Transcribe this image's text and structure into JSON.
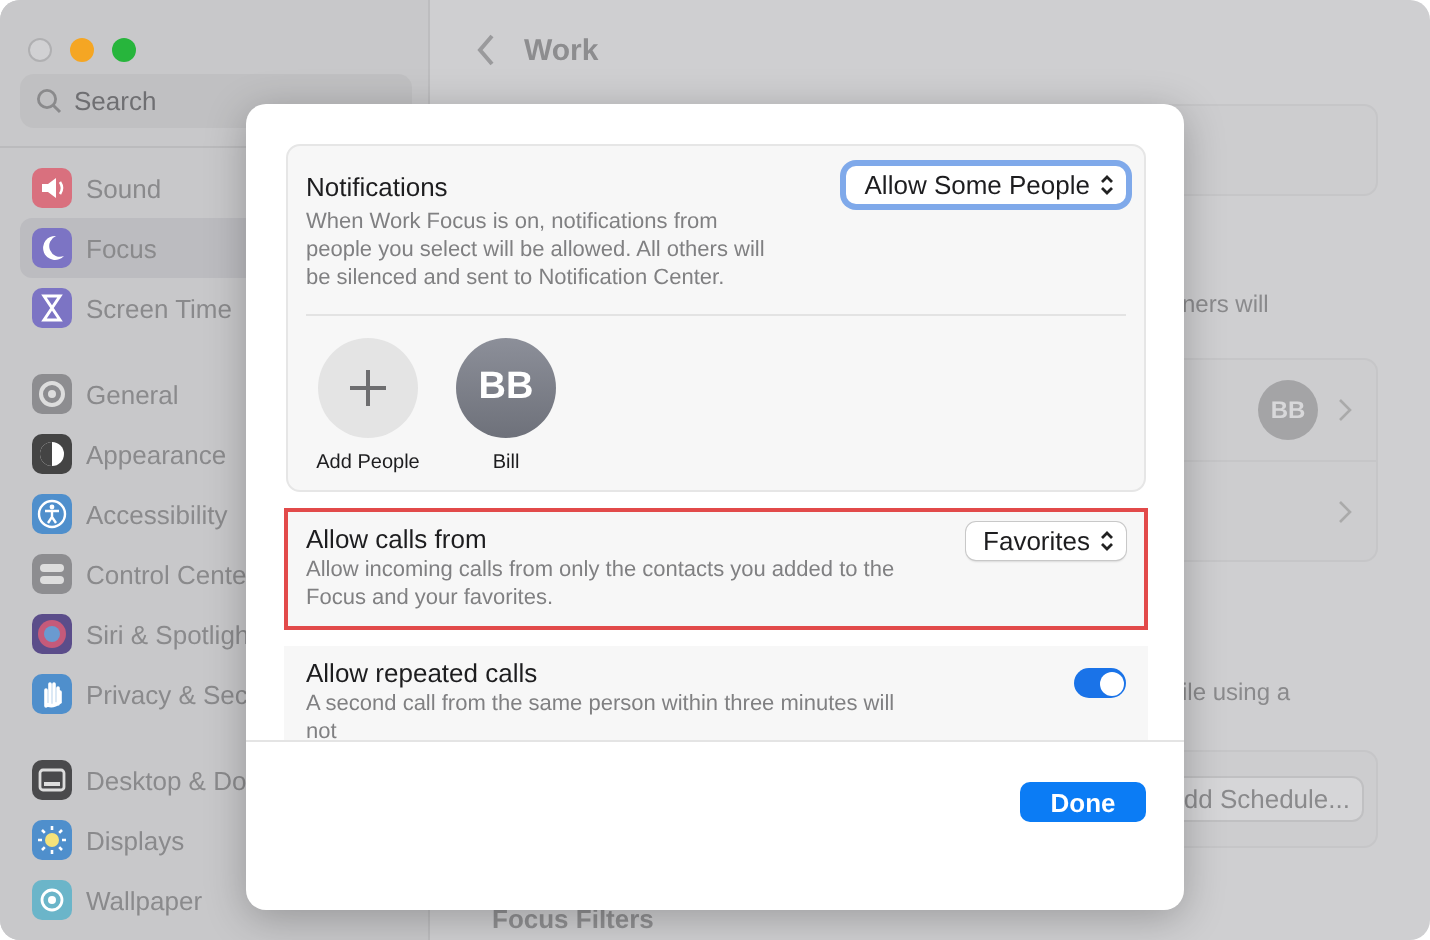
{
  "window": {
    "title": "Work"
  },
  "sidebar": {
    "search": {
      "placeholder": "Search"
    },
    "groups": [
      [
        {
          "label": "Sound",
          "selected": false
        },
        {
          "label": "Focus",
          "selected": true
        },
        {
          "label": "Screen Time",
          "selected": false
        }
      ],
      [
        {
          "label": "General",
          "selected": false
        },
        {
          "label": "Appearance",
          "selected": false
        },
        {
          "label": "Accessibility",
          "selected": false
        },
        {
          "label": "Control Cente",
          "selected": false
        },
        {
          "label": "Siri & Spotligh",
          "selected": false
        },
        {
          "label": "Privacy & Sec",
          "selected": false
        }
      ],
      [
        {
          "label": "Desktop & Do",
          "selected": false
        },
        {
          "label": "Displays",
          "selected": false
        },
        {
          "label": "Wallpaper",
          "selected": false
        }
      ]
    ]
  },
  "background": {
    "notifications_text": "ners will",
    "person_avatar": "BB",
    "schedule_text": "ile using a",
    "add_schedule_button": "dd Schedule...",
    "focus_filters_title": "Focus Filters"
  },
  "dialog": {
    "notifications": {
      "title": "Notifications",
      "description": "When Work Focus is on, notifications from people you select will be allowed. All others will be silenced and sent to Notification Center.",
      "dropdown": {
        "value": "Allow Some People",
        "focused": true
      },
      "people": [
        {
          "kind": "add",
          "label": "Add People"
        },
        {
          "kind": "contact",
          "initials": "BB",
          "label": "Bill"
        }
      ]
    },
    "settings": [
      {
        "kind": "select",
        "title": "Allow calls from",
        "description": "Allow incoming calls from only the contacts you added to the Focus and your favorites.",
        "value": "Favorites",
        "highlighted": true
      },
      {
        "kind": "toggle",
        "title": "Allow repeated calls",
        "description": "A second call from the same person within three minutes will not",
        "on": true,
        "highlighted": false
      }
    ],
    "done_button": "Done"
  }
}
